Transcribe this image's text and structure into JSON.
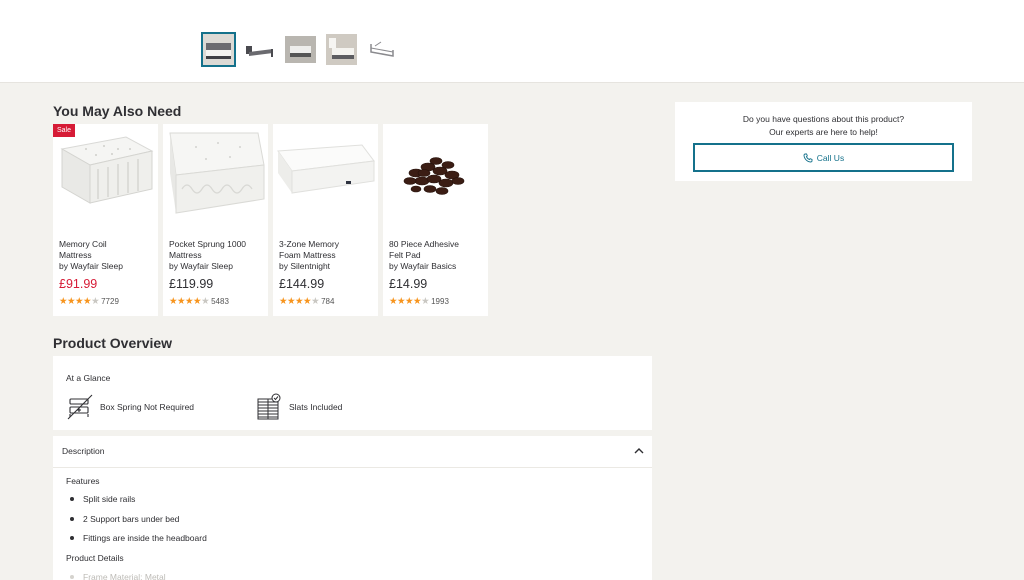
{
  "gallery": {
    "thumbnails": [
      {
        "icon": "bed-photo-icon",
        "active": true
      },
      {
        "icon": "bed-frame-icon",
        "active": false
      },
      {
        "icon": "bedroom-icon",
        "active": false
      },
      {
        "icon": "bedroom-icon",
        "active": false
      },
      {
        "icon": "bed-frame-sketch-icon",
        "active": false
      }
    ]
  },
  "also_need": {
    "title": "You May Also Need",
    "products": [
      {
        "name_line1": "Memory Coil",
        "name_line2": "Mattress",
        "brand": "by Wayfair Sleep",
        "price": "£91.99",
        "rating_count": "7729",
        "sale_badge": "Sale",
        "stars_full": 4
      },
      {
        "name_line1": "Pocket Sprung 1000",
        "name_line2": "Mattress",
        "brand": "by Wayfair Sleep",
        "price": "£119.99",
        "rating_count": "5483",
        "sale_badge": "",
        "stars_full": 4
      },
      {
        "name_line1": "3-Zone Memory",
        "name_line2": "Foam Mattress",
        "brand": "by Silentnight",
        "price": "£144.99",
        "rating_count": "784",
        "sale_badge": "",
        "stars_full": 4
      },
      {
        "name_line1": "80 Piece Adhesive",
        "name_line2": "Felt Pad",
        "brand": "by Wayfair Basics",
        "price": "£14.99",
        "rating_count": "1993",
        "sale_badge": "",
        "stars_full": 4
      }
    ]
  },
  "expert": {
    "line1": "Do you have questions about this product?",
    "line2": "Our experts are here to help!",
    "button_label": "Call Us"
  },
  "overview": {
    "title": "Product Overview",
    "glance_title": "At a Glance",
    "glance_items": [
      {
        "label": "Box Spring Not Required",
        "icon": "box-spring-icon"
      },
      {
        "label": "Slats Included",
        "icon": "slats-icon"
      }
    ]
  },
  "description": {
    "header": "Description",
    "features_heading": "Features",
    "features": [
      "Split side rails",
      "2 Support bars under bed",
      "Fittings are inside the headboard"
    ],
    "details_heading": "Product Details",
    "details_first": "Frame Material: Metal"
  },
  "colors": {
    "accent": "#14718b",
    "sale": "#d61b36",
    "star": "#f7941d",
    "background": "#f3f2ee"
  }
}
